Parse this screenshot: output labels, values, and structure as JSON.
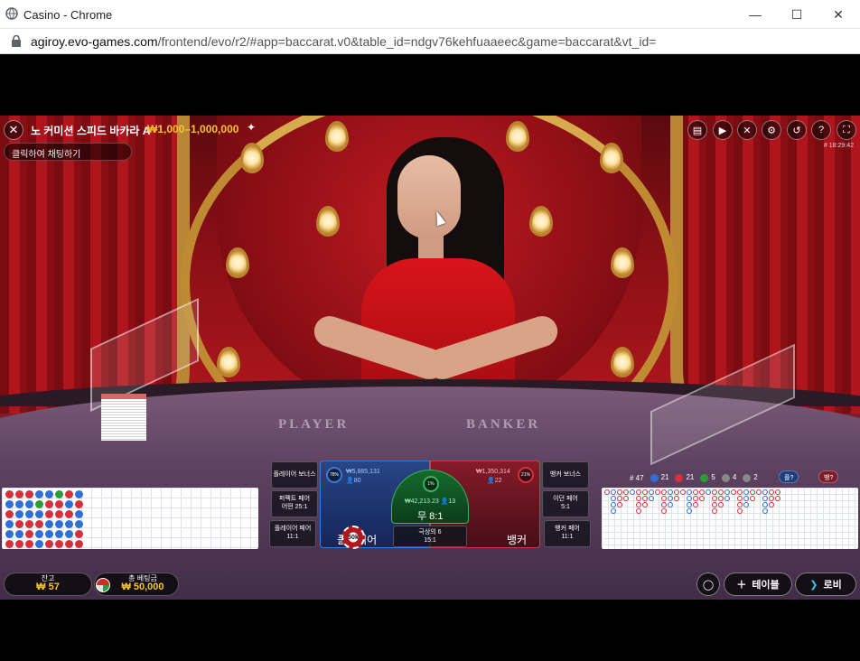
{
  "window": {
    "title": "Casino - Chrome",
    "url_prefix": "agiroy.evo-games.com",
    "url_path": "/frontend/evo/r2/#app=baccarat.v0&table_id=ndgv76kehfuaaeec&game=baccarat&vt_id=",
    "minimize": "—",
    "maximize": "☐",
    "close": "✕"
  },
  "header": {
    "game_title": "노 커미션 스피드 바카라 A",
    "limits": "₩1,000–1,000,000",
    "chat_placeholder": "클릭하여 채팅하기",
    "clock": "# 18:29:42"
  },
  "table": {
    "player_label": "PLAYER",
    "banker_label": "BANKER"
  },
  "stats": {
    "hands": "# 47",
    "player_count": "21",
    "banker_count": "21",
    "tie_count": "5",
    "player_pair": "4",
    "banker_pair": "2",
    "player_pred": "플?",
    "banker_pred": "뱅?"
  },
  "bets": {
    "player_bonus": "플레이어 보너스",
    "perfect_pair_l1": "퍼펙트 페어",
    "perfect_pair_l2": "어떤 25:1",
    "player_pair_l1": "플레이어 페어",
    "player_pair_l2": "11:1",
    "banker_bonus": "뱅커 보너스",
    "either_pair_l1": "이던 페어",
    "either_pair_l2": "5:1",
    "banker_pair_l1": "뱅커 페어",
    "banker_pair_l2": "11:1",
    "player_zone": "플레이어",
    "banker_zone": "뱅커",
    "tie_label": "무 8:1",
    "tie_total": "₩42,213.23 👤13",
    "tie_pct": "1%",
    "super6_l1": "극상의 6",
    "super6_l2": "15:1",
    "player_total": "₩5,885,131",
    "player_players": "👤80",
    "player_pct": "78%",
    "banker_total": "₩1,350,314",
    "banker_players": "👤22",
    "banker_pct": "21%",
    "chip_value": "50k"
  },
  "footer": {
    "balance_label": "잔고",
    "balance_value": "₩ 57",
    "totalbet_label": "총 베팅금",
    "totalbet_value": "₩ 50,000",
    "table_button": "테이블",
    "lobby_button": "로비"
  },
  "colors": {
    "player": "#2f6fd6",
    "banker": "#d6303c",
    "tie": "#2a9d3a",
    "gold": "#f7c430"
  },
  "icons": {
    "chat": "chat-icon",
    "video": "video-icon",
    "sound": "sound-off-icon",
    "settings": "gear-icon",
    "history": "history-icon",
    "help": "help-icon",
    "fullscreen": "fullscreen-icon"
  }
}
